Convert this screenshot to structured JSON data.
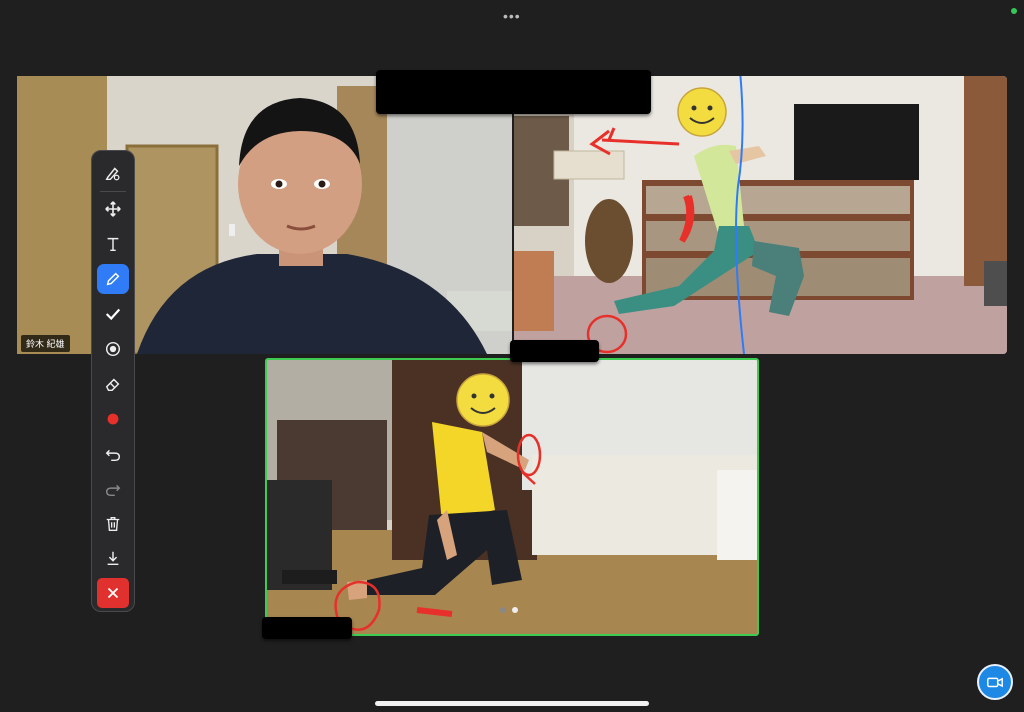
{
  "participants": [
    {
      "id": "left",
      "name_label": "鈴木 紀雄"
    },
    {
      "id": "right",
      "name_label": ""
    },
    {
      "id": "bottom",
      "name_label": ""
    }
  ],
  "toolbar": {
    "tools": [
      {
        "name": "brush-settings-icon"
      },
      {
        "name": "move-icon"
      },
      {
        "name": "text-icon",
        "glyph": "T"
      },
      {
        "name": "pen-icon",
        "active": true
      },
      {
        "name": "checkmark-icon"
      },
      {
        "name": "spotlight-icon"
      },
      {
        "name": "eraser-icon"
      },
      {
        "name": "color-icon",
        "value": "#e8302a"
      },
      {
        "name": "undo-icon"
      },
      {
        "name": "redo-icon"
      },
      {
        "name": "trash-icon"
      },
      {
        "name": "save-icon"
      },
      {
        "name": "close-icon"
      }
    ]
  },
  "pagination": {
    "pages": 2,
    "current": 2
  },
  "colors": {
    "active_speaker_border": "#3ecb52",
    "annotation_red": "#e8302a",
    "annotation_blue": "#2f7cf6",
    "tool_active": "#2f7cf6",
    "close": "#e0312e"
  }
}
